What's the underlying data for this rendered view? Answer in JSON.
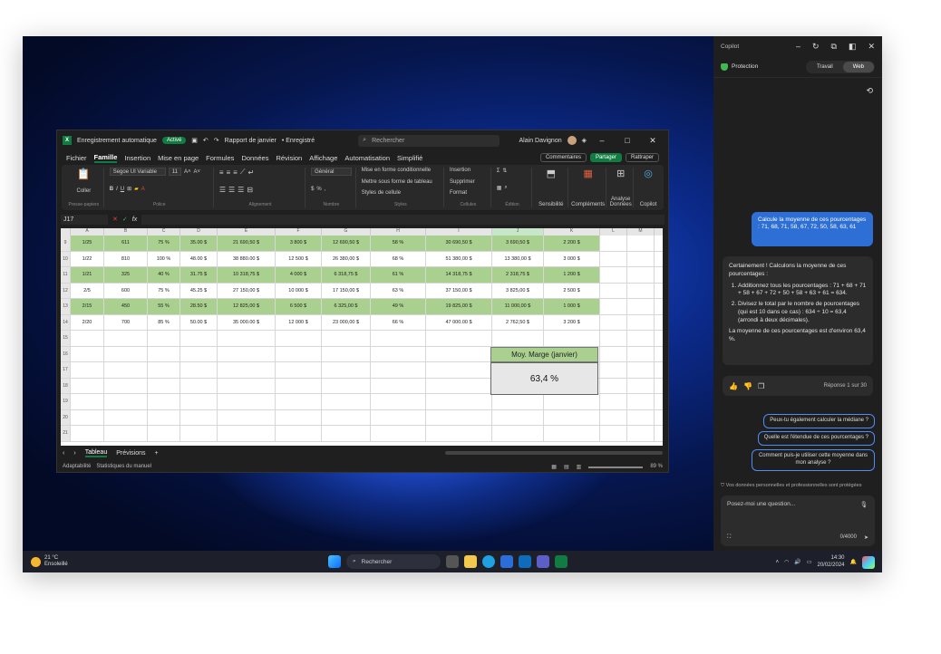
{
  "excel": {
    "autosave_label": "Enregistrement automatique",
    "autosave_state": "Activé",
    "doc_title": "Rapport de janvier",
    "saved_state": "• Enregistré",
    "search_placeholder": "Rechercher",
    "user": "Alain Davignon",
    "menu": [
      "Fichier",
      "Famille",
      "Insertion",
      "Mise en page",
      "Formules",
      "Données",
      "Révision",
      "Affichage",
      "Automatisation",
      "Simplifié"
    ],
    "comments": "Commentaires",
    "share": "Partager",
    "record": "Rattraper",
    "ribbon": {
      "paste": "Coller",
      "clipboard": "Presse-papiers",
      "font_name": "Segoe UI Variable",
      "font_size": "11",
      "font_group": "Police",
      "align_group": "Alignement",
      "number_format": "Général",
      "number_group": "Nombre",
      "cond_format": "Mise en forme conditionnelle",
      "table_format": "Mettre sous forme de tableau",
      "cell_styles": "Styles de cellule",
      "styles_group": "Styles",
      "insert": "Insertion",
      "delete": "Supprimer",
      "format": "Format",
      "cells_group": "Cellules",
      "edit_group": "Édition",
      "sensitivity": "Sensibilité",
      "addins": "Compléments",
      "analyze": "Analyse Données",
      "copilot": "Copilot"
    },
    "name_box": "J17",
    "columns": [
      "A",
      "B",
      "C",
      "D",
      "E",
      "F",
      "G",
      "H",
      "I",
      "J",
      "K",
      "L",
      "M"
    ],
    "rows": [
      {
        "n": "9",
        "g": true,
        "v": [
          "1/25",
          "611",
          "75 %",
          "35.00 $",
          "21 690,50 $",
          "3 800 $",
          "12 690,50 $",
          "58 %",
          "30 690,50 $",
          "3 690,50 $",
          "2 200 $"
        ]
      },
      {
        "n": "10",
        "g": false,
        "v": [
          "1/22",
          "810",
          "100 %",
          "48.00 $",
          "38 880.00 $",
          "12 500 $",
          "26 380,00 $",
          "68 %",
          "51 380,00 $",
          "13 380,00 $",
          "3 000 $"
        ]
      },
      {
        "n": "11",
        "g": true,
        "v": [
          "1/21",
          "325",
          "40 %",
          "31.75 $",
          "10 318,75 $",
          "4 000 $",
          "6 318,75 $",
          "61 %",
          "14 318,75 $",
          "2 318,75 $",
          "1 200 $"
        ]
      },
      {
        "n": "12",
        "g": false,
        "v": [
          "2/5",
          "600",
          "75 %",
          "45.25 $",
          "27 150,00 $",
          "10 000 $",
          "17 150,00 $",
          "63 %",
          "37 150,00 $",
          "3 825,00 $",
          "2 500 $"
        ]
      },
      {
        "n": "13",
        "g": true,
        "v": [
          "2/15",
          "450",
          "55 %",
          "28.50 $",
          "12 825,00 $",
          "6 500 $",
          "6 325,00 $",
          "49 %",
          "19 825,00 $",
          "11 000,00 $",
          "1 000 $"
        ]
      },
      {
        "n": "14",
        "g": false,
        "v": [
          "2/20",
          "700",
          "85 %",
          "50.00 $",
          "35 000.00 $",
          "12 000 $",
          "23 000,00 $",
          "66 %",
          "47 000.00 $",
          "2 762,50 $",
          "3 200 $"
        ]
      },
      {
        "n": "15",
        "g": false,
        "v": [
          "",
          "",
          "",
          "",
          "",
          "",
          "",
          "",
          "",
          "",
          ""
        ]
      },
      {
        "n": "16",
        "g": false,
        "v": [
          "",
          "",
          "",
          "",
          "",
          "",
          "",
          "",
          "",
          "",
          ""
        ]
      },
      {
        "n": "17",
        "g": false,
        "v": [
          "",
          "",
          "",
          "",
          "",
          "",
          "",
          "",
          "",
          "",
          ""
        ]
      },
      {
        "n": "18",
        "g": false,
        "v": [
          "",
          "",
          "",
          "",
          "",
          "",
          "",
          "",
          "",
          "",
          ""
        ]
      },
      {
        "n": "19",
        "g": false,
        "v": [
          "",
          "",
          "",
          "",
          "",
          "",
          "",
          "",
          "",
          "",
          ""
        ]
      },
      {
        "n": "20",
        "g": false,
        "v": [
          "",
          "",
          "",
          "",
          "",
          "",
          "",
          "",
          "",
          "",
          ""
        ]
      },
      {
        "n": "21",
        "g": false,
        "v": [
          "",
          "",
          "",
          "",
          "",
          "",
          "",
          "",
          "",
          "",
          ""
        ]
      }
    ],
    "summary_label": "Moy. Marge (janvier)",
    "summary_value": "63,4 %",
    "sheets": [
      "Tableau",
      "Prévisions"
    ],
    "status_left": [
      "Adaptabilité",
      "Statistiques du manuel"
    ],
    "zoom": "89 %"
  },
  "copilot": {
    "title": "Copilot",
    "protection": "Protection",
    "tab_work": "Travail",
    "tab_web": "Web",
    "user_msg": "Calcule la moyenne de ces pourcentages : 71, 68, 71, 58, 67, 72, 50, 58, 63, 61",
    "answer_intro": "Certainement ! Calculons la moyenne de ces pourcentages :",
    "step1": "Additionnez tous les pourcentages : 71 + 68 + 71 + 58 + 67 + 72 + 50 + 58 + 63 + 61 = 634.",
    "step2": "Divisez le total par le nombre de pourcentages (qui est 10 dans ce cas) : 634 ÷ 10 = 63,4 (arrondi à deux décimales).",
    "answer_end": "La moyenne de ces pourcentages est d'environ 63,4 %.",
    "page_count": "Réponse 1 sur 30",
    "suggestions": [
      "Peux-tu également calculer la médiane ?",
      "Quelle est l'étendue de ces pourcentages ?",
      "Comment puis-je utiliser cette moyenne dans mon analyse ?"
    ],
    "privacy": "Vos données personnelles et professionnelles sont protégées",
    "ask_placeholder": "Posez-moi une question...",
    "char_count": "0/4000"
  },
  "taskbar": {
    "temp": "21 °C",
    "weather": "Ensoleillé",
    "search": "Rechercher",
    "time": "14:30",
    "date": "20/02/2024"
  },
  "colors": {
    "accent_green": "#107c41",
    "row_green": "#a9d08e",
    "copilot_blue": "#2e6fd6"
  }
}
